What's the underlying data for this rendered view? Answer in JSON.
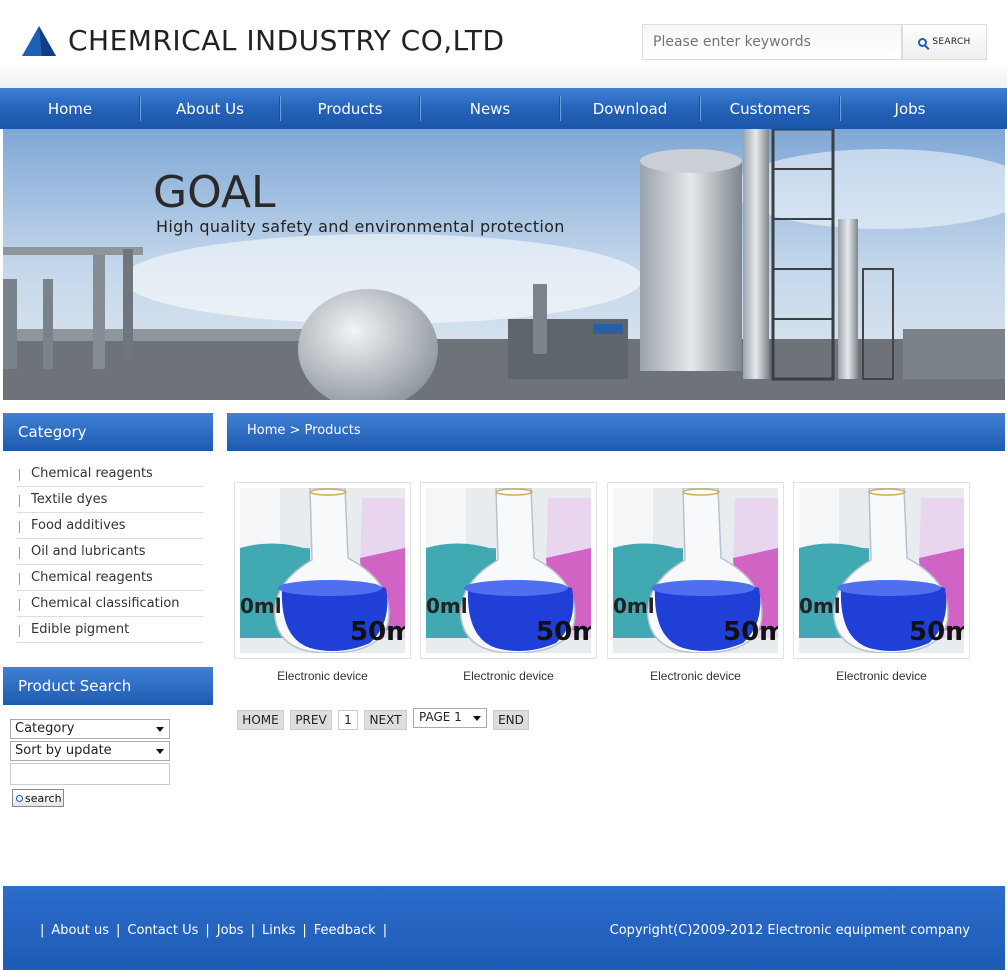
{
  "header": {
    "company_name": "CHEMRICAL INDUSTRY CO,LTD",
    "search_placeholder": "Please enter keywords",
    "search_button": "SEARCH",
    "logo_color": "#1d5fb4"
  },
  "nav": {
    "items": [
      {
        "label": "Home"
      },
      {
        "label": "About Us"
      },
      {
        "label": "Products"
      },
      {
        "label": "News"
      },
      {
        "label": "Download"
      },
      {
        "label": "Customers"
      },
      {
        "label": "Jobs"
      }
    ]
  },
  "banner": {
    "title": "GOAL",
    "subtitle": "High quality safety and environmental protection"
  },
  "sidebar": {
    "category_title": "Category",
    "categories": [
      "Chemical reagents",
      "Textile dyes",
      "Food additives",
      "Oil and lubricants",
      "Chemical reagents",
      "Chemical classification",
      "Edible pigment"
    ],
    "search_title": "Product Search",
    "category_select": "Category",
    "sort_select": "Sort by update",
    "search_button": "search"
  },
  "main": {
    "breadcrumb": "Home > Products",
    "products": [
      {
        "label": "Electronic device",
        "image_icon": "lab-flask-image"
      },
      {
        "label": "Electronic device",
        "image_icon": "lab-flask-image"
      },
      {
        "label": "Electronic device",
        "image_icon": "lab-flask-image"
      },
      {
        "label": "Electronic device",
        "image_icon": "lab-flask-image"
      }
    ],
    "flask_text": "50m",
    "flask_text_left": "0ml",
    "pager": {
      "home": "HOME",
      "prev": "PREV",
      "current": "1",
      "next": "NEXT",
      "page_select": "PAGE 1",
      "end": "END"
    }
  },
  "footer": {
    "links": [
      "About us",
      "Contact Us",
      "Jobs",
      "Links",
      "Feedback"
    ],
    "copyright": "Copyright(C)2009-2012 Electronic equipment company"
  },
  "colors": {
    "brand_blue": "#1e5bb0",
    "nav_light": "#3f80d6"
  }
}
